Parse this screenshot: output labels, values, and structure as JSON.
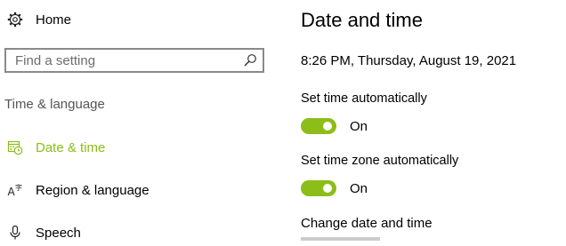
{
  "sidebar": {
    "home": {
      "label": "Home",
      "icon": "gear-icon"
    },
    "search": {
      "placeholder": "Find a setting",
      "icon": "search-icon"
    },
    "section_label": "Time & language",
    "items": [
      {
        "label": "Date & time",
        "icon": "clock-calendar-icon",
        "active": true
      },
      {
        "label": "Region & language",
        "icon": "language-icon",
        "active": false
      },
      {
        "label": "Speech",
        "icon": "microphone-icon",
        "active": false
      }
    ]
  },
  "main": {
    "title": "Date and time",
    "current_datetime": "8:26 PM, Thursday, August 19, 2021",
    "set_time_auto": {
      "label": "Set time automatically",
      "state": "On"
    },
    "set_timezone_auto": {
      "label": "Set time zone automatically",
      "state": "On"
    },
    "change_label": "Change date and time"
  },
  "colors": {
    "accent": "#8cbd18",
    "section_label": "#555555",
    "search_border": "#8a8a8a"
  }
}
